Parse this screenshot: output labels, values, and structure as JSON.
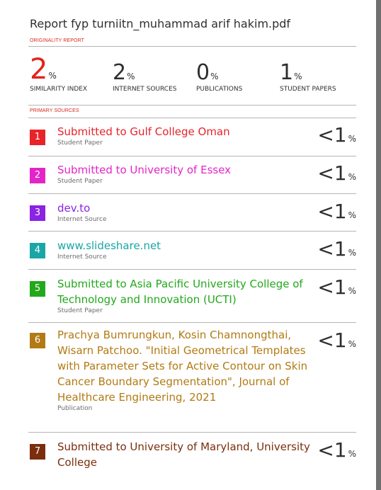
{
  "report_title": "Report fyp turniitn_muhammad arif hakim.pdf",
  "originality_label": "ORIGINALITY REPORT",
  "stats": [
    {
      "value": "2",
      "unit": "%",
      "label": "SIMILARITY INDEX",
      "color": "#e0241c"
    },
    {
      "value": "2",
      "unit": "%",
      "label": "INTERNET SOURCES"
    },
    {
      "value": "0",
      "unit": "%",
      "label": "PUBLICATIONS"
    },
    {
      "value": "1",
      "unit": "%",
      "label": "STUDENT PAPERS"
    }
  ],
  "primary_label": "PRIMARY SOURCES",
  "sources": [
    {
      "num": "1",
      "name": "Submitted to Gulf College Oman",
      "type": "Student Paper",
      "score": "<1",
      "unit": "%",
      "color": "#e8232a"
    },
    {
      "num": "2",
      "name": "Submitted to University of Essex",
      "type": "Student Paper",
      "score": "<1",
      "unit": "%",
      "color": "#e325c8"
    },
    {
      "num": "3",
      "name": "dev.to",
      "type": "Internet Source",
      "score": "<1",
      "unit": "%",
      "color": "#8a23e3"
    },
    {
      "num": "4",
      "name": "www.slideshare.net",
      "type": "Internet Source",
      "score": "<1",
      "unit": "%",
      "color": "#1aa6a6"
    },
    {
      "num": "5",
      "name": "Submitted to Asia Pacific University College of Technology and Innovation (UCTI)",
      "type": "Student Paper",
      "score": "<1",
      "unit": "%",
      "color": "#23a81c"
    },
    {
      "num": "6",
      "name": "Prachya Bumrungkun, Kosin Chamnongthai, Wisarn Patchoo. \"Initial Geometrical Templates with Parameter Sets for Active Contour on Skin Cancer Boundary Segmentation\", Journal of Healthcare Engineering, 2021",
      "type": "Publication",
      "score": "<1",
      "unit": "%",
      "color": "#b27a14"
    },
    {
      "num": "7",
      "name": "Submitted to University of Maryland, University College",
      "type": "",
      "score": "<1",
      "unit": "%",
      "color": "#7a2e0e"
    }
  ]
}
